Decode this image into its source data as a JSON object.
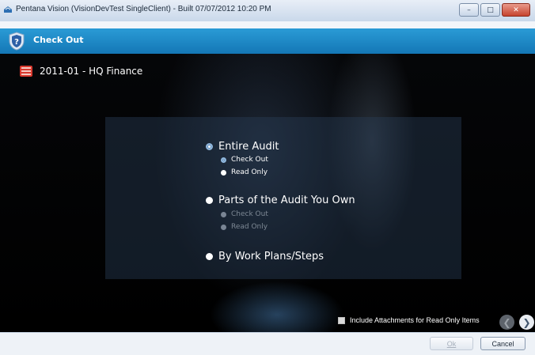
{
  "window": {
    "title": "Pentana Vision (VisionDevTest SingleClient) - Built 07/07/2012 10:20 PM",
    "controls": {
      "minimize": "–",
      "maximize": "□",
      "close": "✕"
    }
  },
  "header": {
    "title": "Check Out",
    "icon": "help-shield-icon"
  },
  "audit": {
    "label": "2011-01 - HQ Finance",
    "icon": "audit-book-icon"
  },
  "options": {
    "entire_audit": {
      "label": "Entire Audit",
      "selected": true,
      "sub": [
        {
          "label": "Check Out",
          "selected": true
        },
        {
          "label": "Read Only",
          "selected": false
        }
      ]
    },
    "parts_owned": {
      "label": "Parts of the Audit You Own",
      "selected": false,
      "sub": [
        {
          "label": "Check Out",
          "enabled": false
        },
        {
          "label": "Read Only",
          "enabled": false
        }
      ]
    },
    "work_plans": {
      "label": "By Work Plans/Steps",
      "selected": false
    }
  },
  "footer": {
    "include_attachments": {
      "label": "Include Attachments for Read Only Items",
      "checked": false
    },
    "back_icon": "arrow-left-icon",
    "next_icon": "arrow-right-icon"
  },
  "buttons": {
    "ok_label": "Ok",
    "ok_enabled": false,
    "cancel_label": "Cancel"
  },
  "colors": {
    "header_blue": "#1e8ccb",
    "stage_bg": "#000000"
  }
}
